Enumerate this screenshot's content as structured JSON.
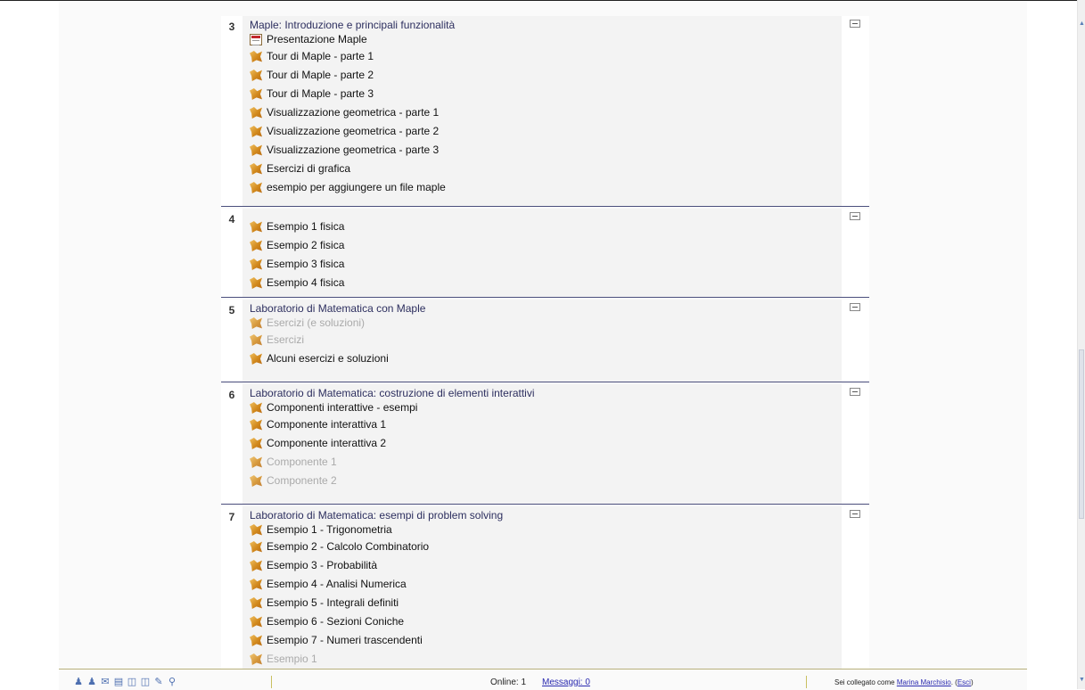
{
  "sections": [
    {
      "number": "3",
      "title": "Maple: Introduzione e principali funzionalità",
      "activities": [
        {
          "label": "Presentazione Maple",
          "icon": "document-icon",
          "dimmed": false
        },
        {
          "label": "Tour di Maple - parte 1",
          "icon": "maple-icon",
          "dimmed": false
        },
        {
          "label": "Tour di Maple - parte 2",
          "icon": "maple-icon",
          "dimmed": false
        },
        {
          "label": "Tour di Maple - parte 3",
          "icon": "maple-icon",
          "dimmed": false
        },
        {
          "label": "Visualizzazione geometrica - parte 1",
          "icon": "maple-icon",
          "dimmed": false
        },
        {
          "label": "Visualizzazione geometrica - parte 2",
          "icon": "maple-icon",
          "dimmed": false
        },
        {
          "label": "Visualizzazione geometrica - parte 3",
          "icon": "maple-icon",
          "dimmed": false
        },
        {
          "label": "Esercizi di grafica",
          "icon": "maple-icon",
          "dimmed": false
        },
        {
          "label": "esempio per aggiungere un file maple",
          "icon": "maple-icon",
          "dimmed": false
        }
      ]
    },
    {
      "number": "4",
      "title": "",
      "activities": [
        {
          "label": "Esempio 1 fisica",
          "icon": "maple-icon",
          "dimmed": false
        },
        {
          "label": "Esempio 2 fisica",
          "icon": "maple-icon",
          "dimmed": false
        },
        {
          "label": "Esempio 3 fisica",
          "icon": "maple-icon",
          "dimmed": false
        },
        {
          "label": "Esempio 4 fisica",
          "icon": "maple-icon",
          "dimmed": false
        }
      ]
    },
    {
      "number": "5",
      "title": "Laboratorio di Matematica con Maple",
      "activities": [
        {
          "label": "Esercizi (e soluzioni)",
          "icon": "maple-icon",
          "dimmed": true
        },
        {
          "label": "Esercizi",
          "icon": "maple-icon",
          "dimmed": true
        },
        {
          "label": "Alcuni esercizi e soluzioni",
          "icon": "maple-icon",
          "dimmed": false
        }
      ]
    },
    {
      "number": "6",
      "title": "Laboratorio di Matematica: costruzione di elementi interattivi",
      "activities": [
        {
          "label": "Componenti interattive - esempi",
          "icon": "maple-icon",
          "dimmed": false
        },
        {
          "label": "Componente interattiva 1",
          "icon": "maple-icon",
          "dimmed": false
        },
        {
          "label": "Componente interattiva 2",
          "icon": "maple-icon",
          "dimmed": false
        },
        {
          "label": "Componente 1",
          "icon": "maple-icon",
          "dimmed": true
        },
        {
          "label": "Componente 2",
          "icon": "maple-icon",
          "dimmed": true
        }
      ]
    },
    {
      "number": "7",
      "title": "Laboratorio di Matematica: esempi di problem solving",
      "activities": [
        {
          "label": "Esempio 1 - Trigonometria",
          "icon": "maple-icon",
          "dimmed": false
        },
        {
          "label": "Esempio 2 - Calcolo Combinatorio",
          "icon": "maple-icon",
          "dimmed": false
        },
        {
          "label": "Esempio 3 - Probabilità",
          "icon": "maple-icon",
          "dimmed": false
        },
        {
          "label": "Esempio 4 - Analisi Numerica",
          "icon": "maple-icon",
          "dimmed": false
        },
        {
          "label": "Esempio 5 - Integrali definiti",
          "icon": "maple-icon",
          "dimmed": false
        },
        {
          "label": "Esempio 6 - Sezioni Coniche",
          "icon": "maple-icon",
          "dimmed": false
        },
        {
          "label": "Esempio 7 - Numeri trascendenti",
          "icon": "maple-icon",
          "dimmed": false
        },
        {
          "label": "Esempio 1",
          "icon": "maple-icon",
          "dimmed": true
        }
      ]
    }
  ],
  "footer": {
    "icons": [
      "user-icon",
      "users-icon",
      "mail-icon",
      "calendar-icon",
      "chat-icon",
      "comments-icon",
      "tag-icon",
      "search-icon"
    ],
    "online": "Online: 1",
    "messages": "Messaggi: 0",
    "login_prefix": "Sei collegato come ",
    "user_name": "Marina Marchisio",
    "login_sep": ". (",
    "logout": "Esci",
    "login_suffix": ")"
  },
  "colors": {
    "section_title": "#2d2f5f",
    "section_border": "#4b4f7d",
    "dimmed_text": "#aaaaaa",
    "link": "#2a2ab0"
  }
}
